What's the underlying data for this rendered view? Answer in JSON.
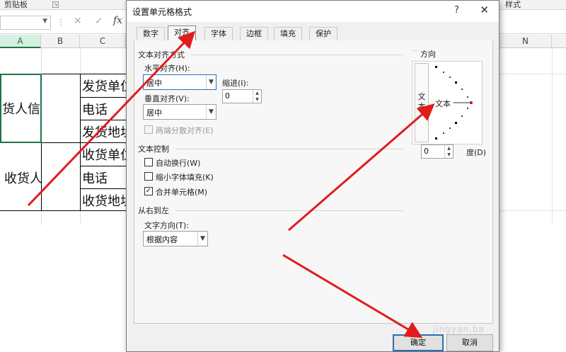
{
  "ribbon": {
    "clipboard_label": "剪贴板",
    "styles_label": "样式"
  },
  "formula_bar": {
    "cancel_symbol": "✕",
    "enter_symbol": "✓",
    "fx_label": "fx"
  },
  "columns": [
    "A",
    "B",
    "C",
    "N"
  ],
  "sheet": {
    "merged_sender": "货人信",
    "merged_receiver": "收货人",
    "rows": [
      "发货单位",
      "电话",
      "发货地址",
      "收货单位",
      "电话",
      "收货地址"
    ]
  },
  "dialog": {
    "title": "设置单元格格式",
    "help": "?",
    "close": "✕",
    "tabs": [
      "数字",
      "对齐",
      "字体",
      "边框",
      "填充",
      "保护"
    ],
    "active_tab": "对齐",
    "text_alignment": {
      "group_label": "文本对齐方式",
      "horizontal_label": "水平对齐(H):",
      "horizontal_value": "居中",
      "indent_label": "缩进(I):",
      "indent_value": "0",
      "vertical_label": "垂直对齐(V):",
      "vertical_value": "居中",
      "distributed_label": "两端分散对齐(E)"
    },
    "text_control": {
      "group_label": "文本控制",
      "wrap_label": "自动换行(W)",
      "shrink_label": "缩小字体填充(K)",
      "merge_label": "合并单元格(M)",
      "merge_checked": "✓"
    },
    "rtl": {
      "group_label": "从右到左",
      "direction_label": "文字方向(T):",
      "direction_value": "根据内容"
    },
    "orientation": {
      "group_label": "方向",
      "vertical_text": "文本",
      "dial_text": "文本",
      "degrees_value": "0",
      "degrees_label": "度(D)"
    },
    "ok_label": "确定",
    "cancel_label": "取消"
  },
  "watermark": "jingyan.ba",
  "colors": {
    "accent": "#217346",
    "annotation_arrow": "#e21b1b",
    "focus": "#2b6fb6"
  }
}
